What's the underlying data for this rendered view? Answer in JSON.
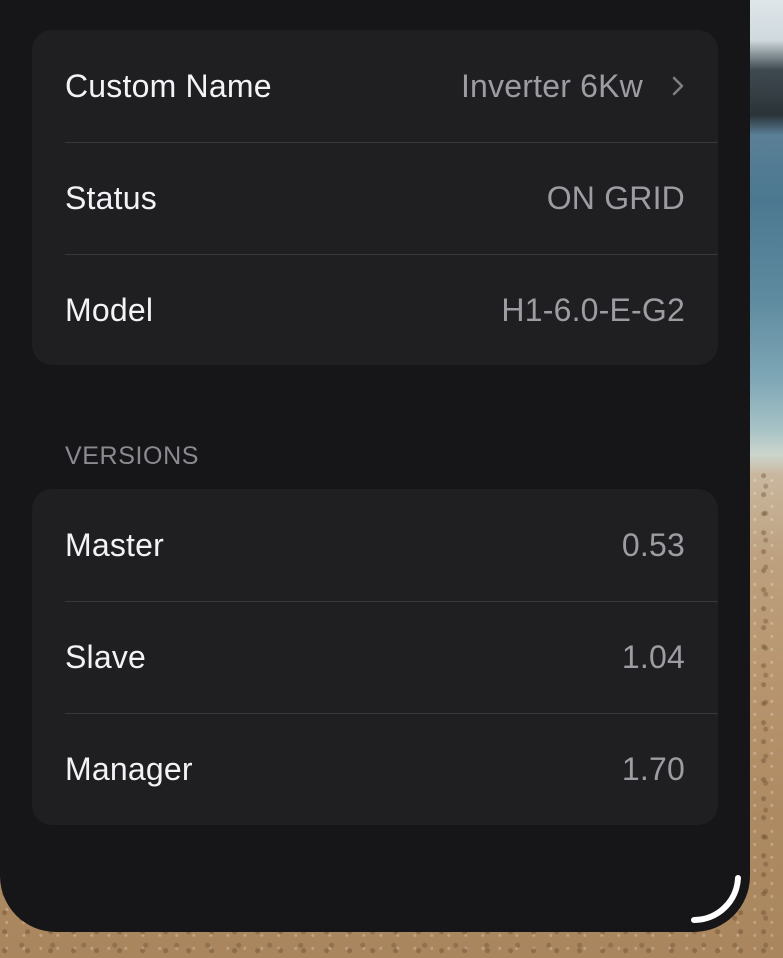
{
  "device_info": {
    "rows": [
      {
        "label": "Custom Name",
        "value": "Inverter 6Kw"
      },
      {
        "label": "Status",
        "value": "ON GRID"
      },
      {
        "label": "Model",
        "value": "H1-6.0-E-G2"
      }
    ]
  },
  "versions": {
    "header": "VERSIONS",
    "rows": [
      {
        "label": "Master",
        "value": "0.53"
      },
      {
        "label": "Slave",
        "value": "1.04"
      },
      {
        "label": "Manager",
        "value": "1.70"
      }
    ]
  },
  "icons": {
    "chevron": "chevron-right-icon",
    "resize": "resize-handle-icon"
  },
  "colors": {
    "sheet_background": "#161618",
    "group_background": "#1f1f21",
    "label_text": "#f2f2f7",
    "value_text": "#9c9ca3"
  }
}
